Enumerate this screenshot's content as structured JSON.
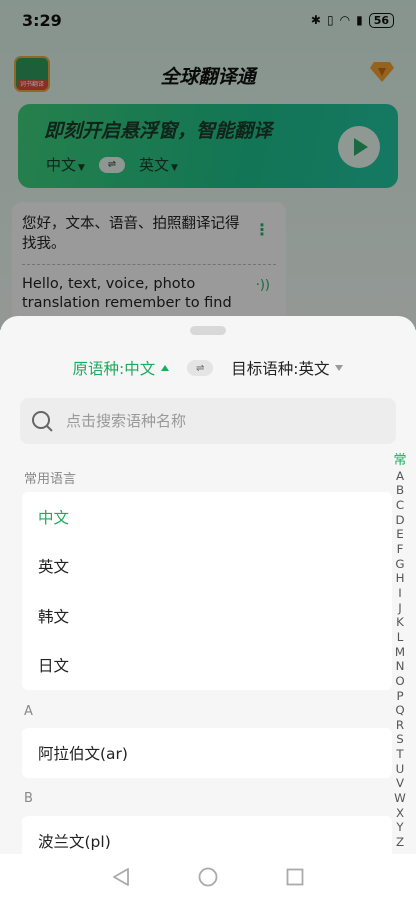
{
  "status_bar": {
    "time": "3:29",
    "battery": "56"
  },
  "app": {
    "title": "全球翻译通",
    "logo_text": "词书翻译"
  },
  "banner": {
    "title": "即刻开启悬浮窗，智能翻译",
    "source_lang": "中文",
    "target_lang": "英文",
    "swap_glyph": "⇌"
  },
  "history_card": {
    "source_text": "您好，文本、语音、拍照翻译记得找我。",
    "translated_text": "Hello, text, voice, photo translation remember to find"
  },
  "sheet": {
    "source_label": "原语种:中文",
    "target_label": "目标语种:英文",
    "swap_glyph": "⇌",
    "search_placeholder": "点击搜索语种名称",
    "sections": [
      {
        "label": "常用语言",
        "items": [
          "中文",
          "英文",
          "韩文",
          "日文"
        ],
        "selected": "中文"
      },
      {
        "label": "A",
        "items": [
          "阿拉伯文(ar)"
        ]
      },
      {
        "label": "B",
        "items": [
          "波兰文(pl)"
        ]
      }
    ],
    "index": [
      "常",
      "A",
      "B",
      "C",
      "D",
      "E",
      "F",
      "G",
      "H",
      "I",
      "J",
      "K",
      "L",
      "M",
      "N",
      "O",
      "P",
      "Q",
      "R",
      "S",
      "T",
      "U",
      "V",
      "W",
      "X",
      "Y",
      "Z"
    ]
  },
  "colors": {
    "accent": "#1faa5e",
    "sheet_bg": "#f6f6f6"
  }
}
